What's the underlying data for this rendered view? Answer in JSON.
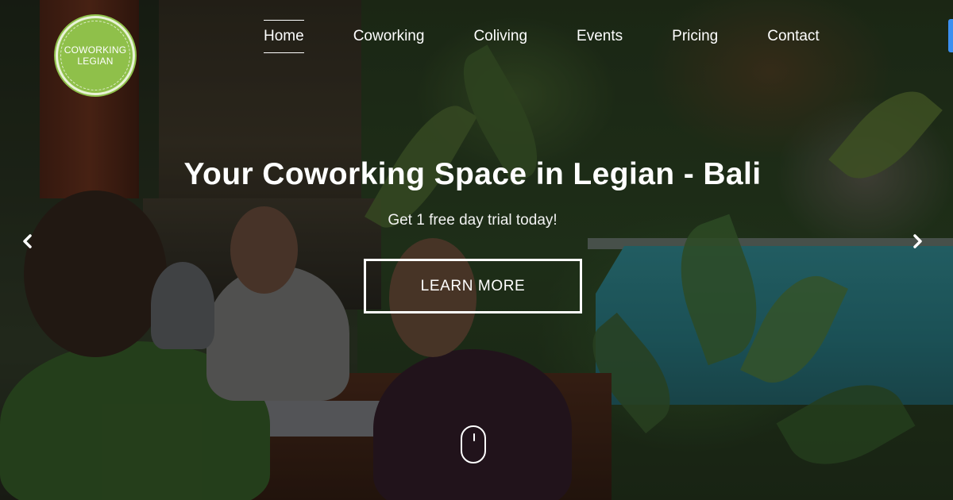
{
  "logo": {
    "line1": "COWORKING",
    "line2": "LEGIAN"
  },
  "nav": {
    "items": [
      {
        "label": "Home",
        "active": true
      },
      {
        "label": "Coworking",
        "active": false
      },
      {
        "label": "Coliving",
        "active": false
      },
      {
        "label": "Events",
        "active": false
      },
      {
        "label": "Pricing",
        "active": false
      },
      {
        "label": "Contact",
        "active": false
      }
    ]
  },
  "hero": {
    "title": "Your Coworking Space in Legian - Bali",
    "subtitle": "Get 1 free day trial today!",
    "cta_label": "LEARN MORE"
  },
  "carousel": {
    "prev_icon": "chevron-left-icon",
    "next_icon": "chevron-right-icon"
  },
  "scroll_indicator": {
    "icon": "mouse-scroll-icon"
  },
  "colors": {
    "logo_green": "#8fc04a",
    "text": "#ffffff",
    "corner_accent": "#3b8ff0"
  }
}
